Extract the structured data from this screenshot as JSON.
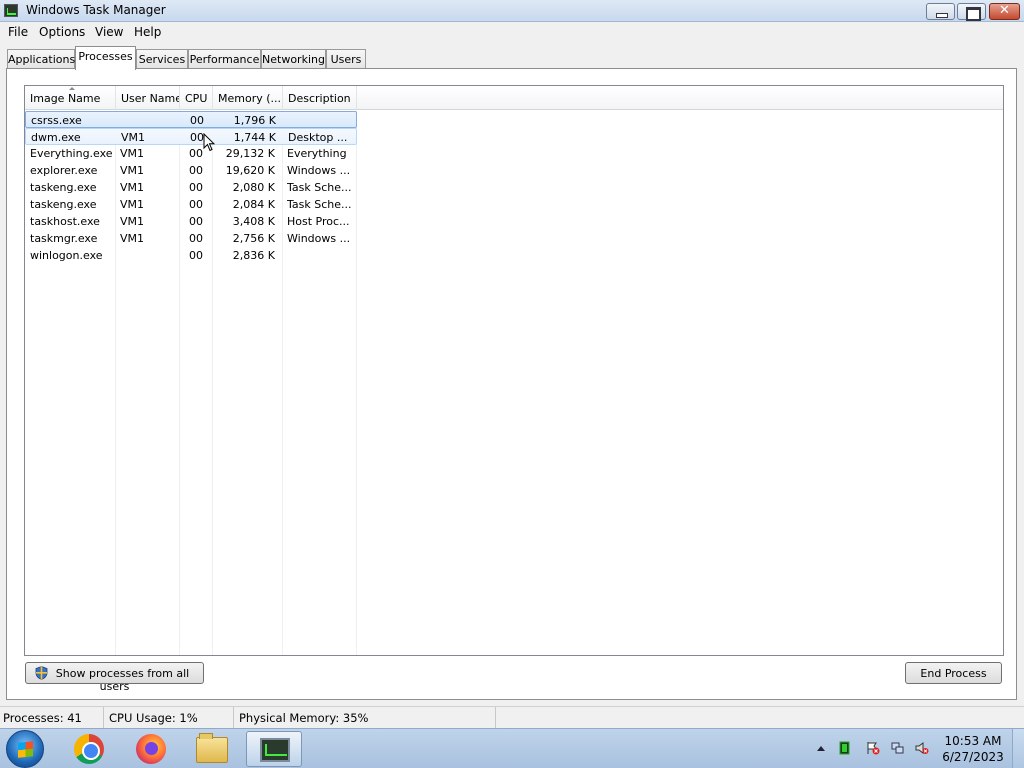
{
  "window": {
    "title": "Windows Task Manager"
  },
  "menu": [
    "File",
    "Options",
    "View",
    "Help"
  ],
  "tabs": [
    "Applications",
    "Processes",
    "Services",
    "Performance",
    "Networking",
    "Users"
  ],
  "active_tab": "Processes",
  "table": {
    "columns": [
      "Image Name",
      "User Name",
      "CPU",
      "Memory (...",
      "Description"
    ],
    "rows": [
      {
        "image": "csrss.exe",
        "user": "",
        "cpu": "00",
        "memory": "1,796 K",
        "description": ""
      },
      {
        "image": "dwm.exe",
        "user": "VM1",
        "cpu": "00",
        "memory": "1,744 K",
        "description": "Desktop ..."
      },
      {
        "image": "Everything.exe",
        "user": "VM1",
        "cpu": "00",
        "memory": "29,132 K",
        "description": "Everything"
      },
      {
        "image": "explorer.exe",
        "user": "VM1",
        "cpu": "00",
        "memory": "19,620 K",
        "description": "Windows ..."
      },
      {
        "image": "taskeng.exe",
        "user": "VM1",
        "cpu": "00",
        "memory": "2,080 K",
        "description": "Task Sche..."
      },
      {
        "image": "taskeng.exe",
        "user": "VM1",
        "cpu": "00",
        "memory": "2,084 K",
        "description": "Task Sche..."
      },
      {
        "image": "taskhost.exe",
        "user": "VM1",
        "cpu": "00",
        "memory": "3,408 K",
        "description": "Host Proc..."
      },
      {
        "image": "taskmgr.exe",
        "user": "VM1",
        "cpu": "00",
        "memory": "2,756 K",
        "description": "Windows ..."
      },
      {
        "image": "winlogon.exe",
        "user": "",
        "cpu": "00",
        "memory": "2,836 K",
        "description": ""
      }
    ]
  },
  "buttons": {
    "show_all_users": "Show processes from all users",
    "end_process": "End Process"
  },
  "status": {
    "processes": "Processes: 41",
    "cpu_usage": "CPU Usage: 1%",
    "physical_memory": "Physical Memory: 35%"
  },
  "taskbar": {
    "apps": [
      "chrome-icon",
      "firefox-icon",
      "folder-icon",
      "taskmgr-icon"
    ],
    "clock_time": "10:53 AM",
    "clock_date": "6/27/2023"
  }
}
